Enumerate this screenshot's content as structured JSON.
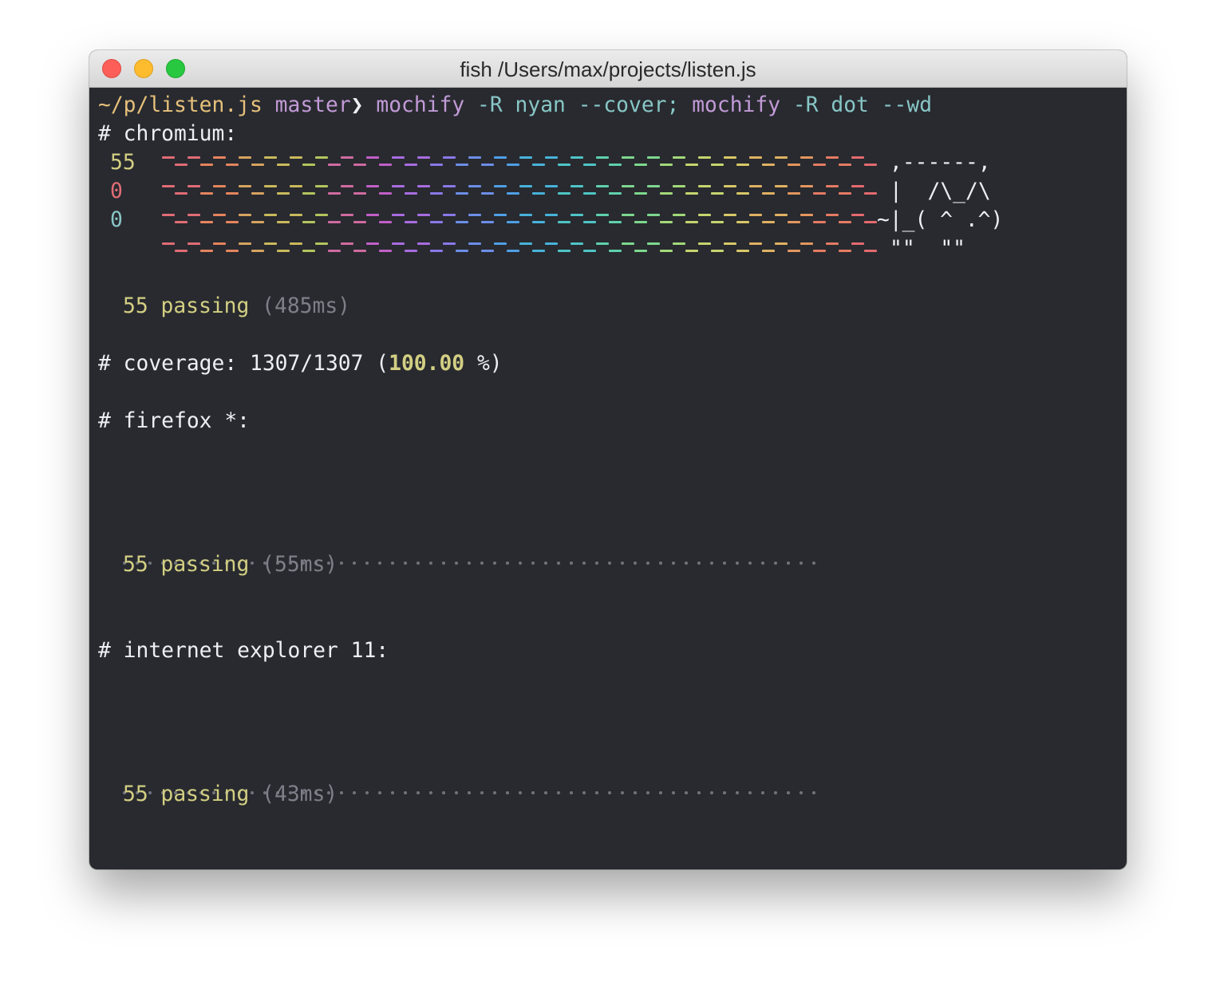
{
  "window": {
    "title": "fish  /Users/max/projects/listen.js"
  },
  "prompt": {
    "path": "~/p/listen.js",
    "branch": "master",
    "symbol": "❯",
    "cmd1_program": "mochify",
    "cmd1_args": "-R nyan --cover;",
    "cmd2_program": "mochify",
    "cmd2_args": "-R dot --wd"
  },
  "chromium": {
    "header": "# chromium:",
    "stats": {
      "passed": "55",
      "failed": "0",
      "pending": "0"
    },
    "cat": {
      "line1": ",------,",
      "line2": "|  /\\_/\\",
      "line3": "~|_( ^ .^)",
      "line4": "\"\"  \"\""
    },
    "passing_count": "55 passing",
    "passing_time": "(485ms)"
  },
  "coverage": {
    "prefix": "# coverage: 1307/1307 (",
    "percent": "100.00",
    "suffix": " %)"
  },
  "firefox": {
    "header": "# firefox *:",
    "dot_count": 55,
    "passing_count": "55 passing",
    "passing_time": "(55ms)"
  },
  "ie": {
    "header": "# internet explorer 11:",
    "dot_count": 55,
    "passing_count": "55 passing",
    "passing_time": "(43ms)"
  },
  "colors": {
    "rainbow": [
      "#e06c75",
      "#e5845e",
      "#d6a35f",
      "#c9b95c",
      "#b4c45e",
      "#d06aa0",
      "#c15fc7",
      "#a86ce0",
      "#8a78e8",
      "#6c8ee8",
      "#4f9fe6",
      "#48b2da",
      "#4fc4c6",
      "#5fd0ac",
      "#7ed78e",
      "#a3d87a",
      "#c6d46e",
      "#d8c768",
      "#dfb163",
      "#e3965f",
      "#e47b63",
      "#e36a6f"
    ]
  }
}
